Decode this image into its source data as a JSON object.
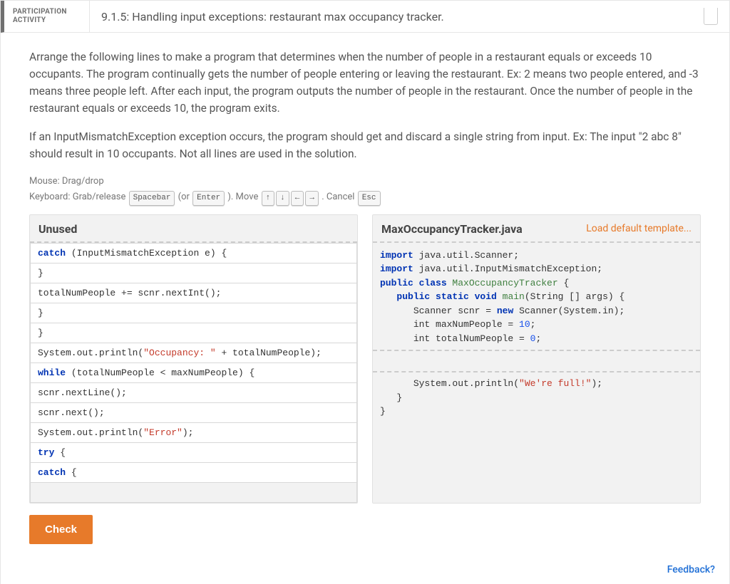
{
  "header": {
    "badge_line1": "PARTICIPATION",
    "badge_line2": "ACTIVITY",
    "title": "9.1.5: Handling input exceptions: restaurant max occupancy tracker."
  },
  "paragraphs": [
    "Arrange the following lines to make a program that determines when the number of people in a restaurant equals or exceeds 10 occupants. The program continually gets the number of people entering or leaving the restaurant. Ex: 2 means two people entered, and -3 means three people left. After each input, the program outputs the number of people in the restaurant. Once the number of people in the restaurant equals or exceeds 10, the program exits.",
    "If an InputMismatchException exception occurs, the program should get and discard a single string from input. Ex: The input \"2 abc 8\" should result in 10 occupants. Not all lines are used in the solution."
  ],
  "instructions": {
    "mouse": "Mouse: Drag/drop",
    "kb_prefix": "Keyboard: Grab/release ",
    "kb_space": "Spacebar",
    "kb_or": " (or ",
    "kb_enter": "Enter",
    "kb_move": " ). Move ",
    "k_up": "↑",
    "k_down": "↓",
    "k_left": "←",
    "k_right": "→",
    "kb_cancel": " . Cancel ",
    "k_esc": "Esc"
  },
  "panels": {
    "unused_title": "Unused",
    "code_title": "MaxOccupancyTracker.java",
    "load_template": "Load default template..."
  },
  "unused_items": [
    {
      "tokens": [
        {
          "t": "catch ",
          "c": "tok-kw"
        },
        {
          "t": "(InputMismatchException e) {"
        }
      ]
    },
    {
      "tokens": [
        {
          "t": "}"
        }
      ]
    },
    {
      "tokens": [
        {
          "t": "totalNumPeople += scnr.nextInt();"
        }
      ]
    },
    {
      "tokens": [
        {
          "t": "}"
        }
      ]
    },
    {
      "tokens": [
        {
          "t": "}"
        }
      ]
    },
    {
      "tokens": [
        {
          "t": "System.out.println("
        },
        {
          "t": "\"Occupancy: \"",
          "c": "tok-str"
        },
        {
          "t": " + totalNumPeople);"
        }
      ]
    },
    {
      "tokens": [
        {
          "t": "while ",
          "c": "tok-kw"
        },
        {
          "t": "(totalNumPeople < maxNumPeople) {"
        }
      ]
    },
    {
      "tokens": [
        {
          "t": "scnr.nextLine();"
        }
      ]
    },
    {
      "tokens": [
        {
          "t": "scnr.next();"
        }
      ]
    },
    {
      "tokens": [
        {
          "t": "System.out.println("
        },
        {
          "t": "\"Error\"",
          "c": "tok-str"
        },
        {
          "t": ");"
        }
      ]
    },
    {
      "tokens": [
        {
          "t": "try ",
          "c": "tok-kw"
        },
        {
          "t": "{"
        }
      ]
    },
    {
      "tokens": [
        {
          "t": "catch ",
          "c": "tok-kw"
        },
        {
          "t": "{"
        }
      ]
    }
  ],
  "code_lines": [
    {
      "indent": 0,
      "tokens": [
        {
          "t": "import ",
          "c": "tok-kw"
        },
        {
          "t": "java.util.Scanner;"
        }
      ]
    },
    {
      "indent": 0,
      "tokens": [
        {
          "t": "import ",
          "c": "tok-kw"
        },
        {
          "t": "java.util.InputMismatchException;"
        }
      ]
    },
    {
      "indent": 0,
      "tokens": [
        {
          "t": ""
        }
      ]
    },
    {
      "indent": 0,
      "tokens": [
        {
          "t": "public class ",
          "c": "tok-kw"
        },
        {
          "t": "MaxOccupancyTracker",
          "c": "tok-cls"
        },
        {
          "t": " {"
        }
      ]
    },
    {
      "indent": 1,
      "tokens": [
        {
          "t": "public static void ",
          "c": "tok-kw"
        },
        {
          "t": "main",
          "c": "tok-cls"
        },
        {
          "t": "(String [] args) {"
        }
      ]
    },
    {
      "indent": 2,
      "tokens": [
        {
          "t": "Scanner scnr = "
        },
        {
          "t": "new ",
          "c": "tok-kw"
        },
        {
          "t": "Scanner(System.in);"
        }
      ]
    },
    {
      "indent": 2,
      "tokens": [
        {
          "t": "int maxNumPeople = "
        },
        {
          "t": "10",
          "c": "tok-num"
        },
        {
          "t": ";"
        }
      ]
    },
    {
      "indent": 2,
      "tokens": [
        {
          "t": "int totalNumPeople = "
        },
        {
          "t": "0",
          "c": "tok-num"
        },
        {
          "t": ";"
        }
      ]
    }
  ],
  "code_after_drop": [
    {
      "indent": 2,
      "tokens": [
        {
          "t": "System.out.println("
        },
        {
          "t": "\"We're full!\"",
          "c": "tok-str"
        },
        {
          "t": ");"
        }
      ]
    },
    {
      "indent": 1,
      "tokens": [
        {
          "t": "}"
        }
      ]
    },
    {
      "indent": 0,
      "tokens": [
        {
          "t": "}"
        }
      ]
    }
  ],
  "buttons": {
    "check": "Check"
  },
  "feedback": "Feedback?"
}
